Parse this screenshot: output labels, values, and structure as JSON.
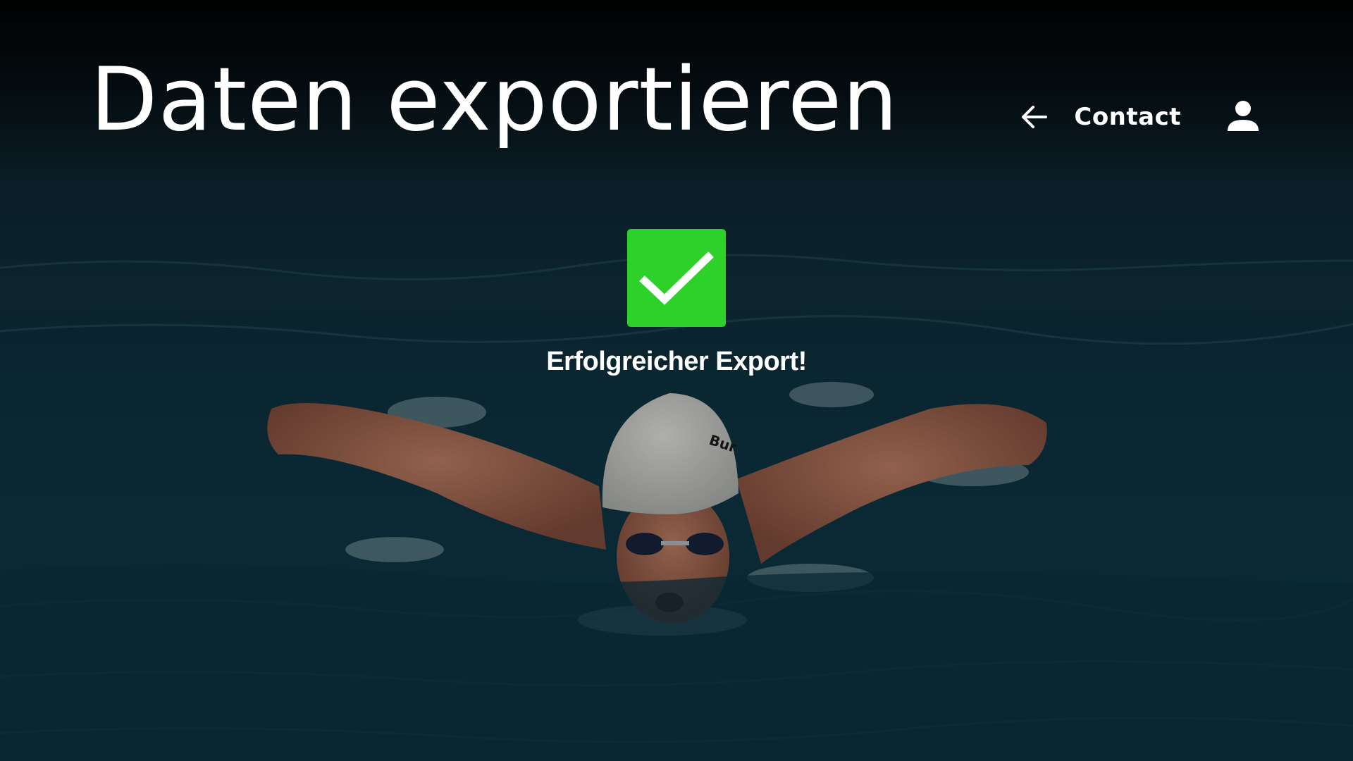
{
  "header": {
    "title": "Daten exportieren"
  },
  "nav": {
    "back_icon": "arrow-left-icon",
    "contact_label": "Contact",
    "user_icon": "user-icon"
  },
  "status": {
    "icon": "checkmark-icon",
    "accent_color": "#2ed12a",
    "message": "Erfolgreicher Export!"
  },
  "background": {
    "subject": "swimmer-butterfly-photo",
    "cap_text": "Bur"
  }
}
